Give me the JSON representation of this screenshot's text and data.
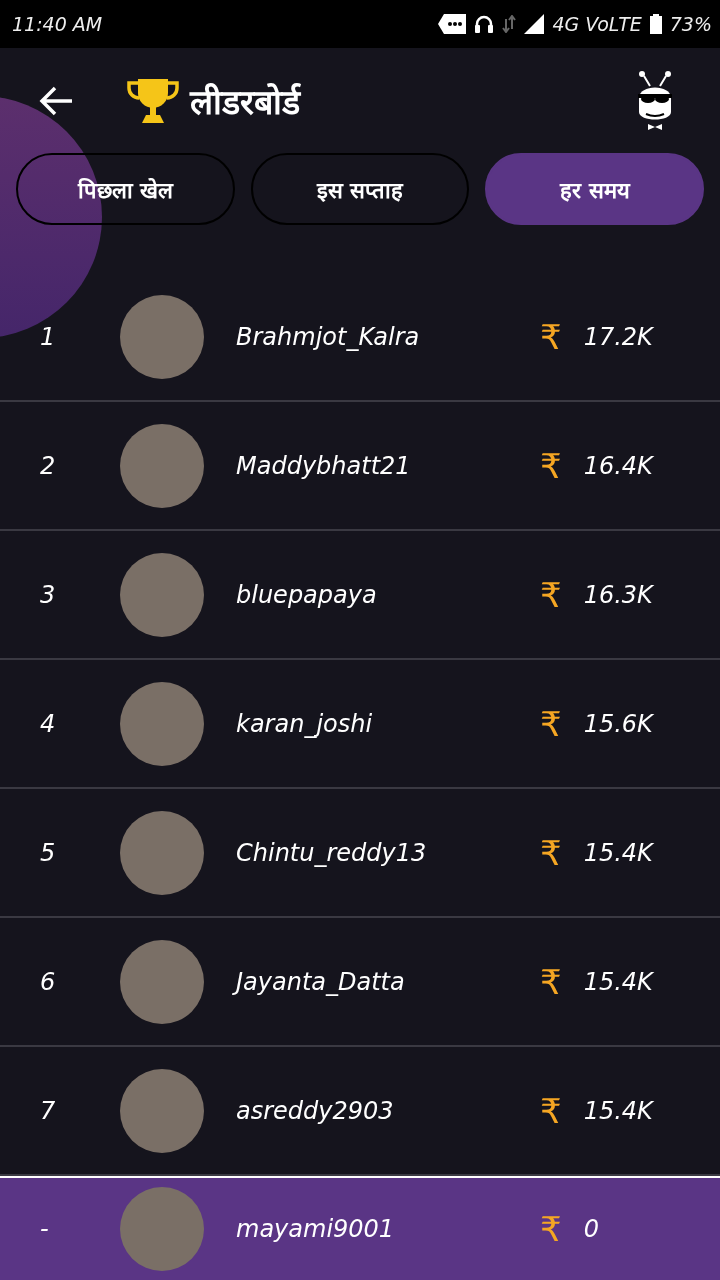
{
  "status_bar": {
    "time": "11:40 AM",
    "network": "4G VoLTE",
    "battery": "73%"
  },
  "header": {
    "title": "लीडरबोर्ड"
  },
  "tabs": [
    {
      "label": "पिछला खेल",
      "selected": false
    },
    {
      "label": "इस सप्ताह",
      "selected": false
    },
    {
      "label": "हर समय",
      "selected": true
    }
  ],
  "rows": [
    {
      "rank": "1",
      "name": "Brahmjot_Kalra",
      "currency": "₹",
      "amount": "17.2K"
    },
    {
      "rank": "2",
      "name": "Maddybhatt21",
      "currency": "₹",
      "amount": "16.4K"
    },
    {
      "rank": "3",
      "name": "bluepapaya",
      "currency": "₹",
      "amount": "16.3K"
    },
    {
      "rank": "4",
      "name": "karan_joshi",
      "currency": "₹",
      "amount": "15.6K"
    },
    {
      "rank": "5",
      "name": "Chintu_reddy13",
      "currency": "₹",
      "amount": "15.4K"
    },
    {
      "rank": "6",
      "name": "Jayanta_Datta",
      "currency": "₹",
      "amount": "15.4K"
    },
    {
      "rank": "7",
      "name": "asreddy2903",
      "currency": "₹",
      "amount": "15.4K"
    }
  ],
  "current_user": {
    "rank": "-",
    "name": "mayami9001",
    "currency": "₹",
    "amount": "0"
  }
}
